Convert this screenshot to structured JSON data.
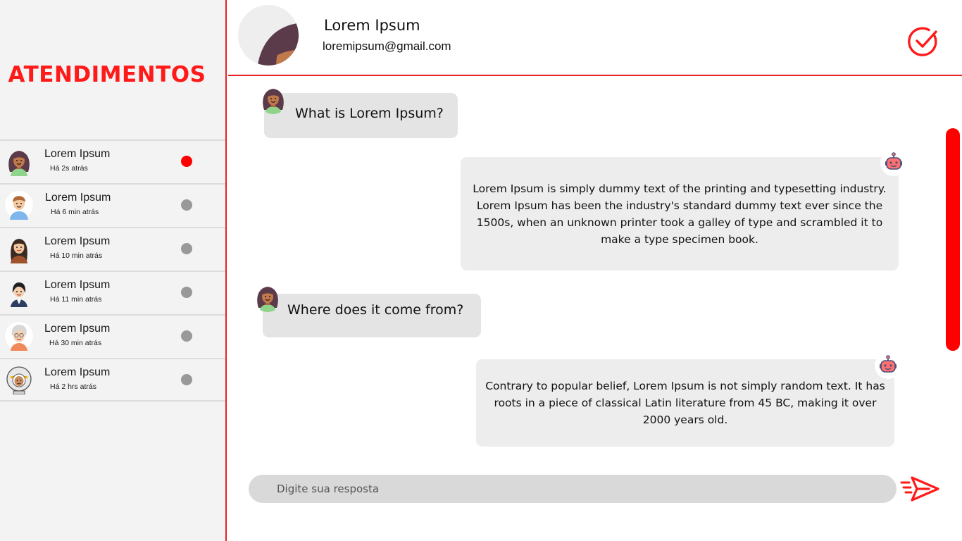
{
  "colors": {
    "accent": "#ff1a1a",
    "active_dot": "#ff0000",
    "idle_dot": "#999999"
  },
  "sidebar": {
    "title": "ATENDIMENTOS",
    "conversations": [
      {
        "name": "Lorem Ipsum",
        "time": "Há 2s atrás",
        "status": "active",
        "avatar": "woman-curly-hair-avatar"
      },
      {
        "name": "Lorem Ipsum",
        "time": "Há 6 min atrás",
        "status": "idle",
        "avatar": "man-avatar"
      },
      {
        "name": "Lorem Ipsum",
        "time": "Há 10 min atrás",
        "status": "idle",
        "avatar": "woman-long-hair-avatar"
      },
      {
        "name": "Lorem Ipsum",
        "time": "Há 11 min atrás",
        "status": "idle",
        "avatar": "woman-suit-avatar"
      },
      {
        "name": "Lorem Ipsum",
        "time": "Há 30 min atrás",
        "status": "idle",
        "avatar": "elderly-woman-avatar"
      },
      {
        "name": "Lorem Ipsum",
        "time": "Há 2 hrs atrás",
        "status": "idle",
        "avatar": "astronaut-avatar"
      }
    ]
  },
  "header": {
    "name": "Lorem Ipsum",
    "email": "loremipsum@gmail.com",
    "action_icon": "check-circle-icon"
  },
  "chat": {
    "messages": [
      {
        "from": "user",
        "text": "What is Lorem Ipsum?"
      },
      {
        "from": "bot",
        "text": "Lorem Ipsum is simply dummy text of the printing and typesetting industry. Lorem Ipsum has been the industry's standard dummy text ever since the 1500s, when an unknown printer took a galley of type and scrambled it to make a type specimen book."
      },
      {
        "from": "user",
        "text": "Where does it come from?"
      },
      {
        "from": "bot",
        "text": "Contrary to popular belief, Lorem Ipsum is not simply random text. It has roots in a piece of classical Latin literature from 45 BC, making it over 2000 years old."
      }
    ]
  },
  "composer": {
    "placeholder": "Digite sua resposta",
    "value": "",
    "send_icon": "send-icon"
  }
}
